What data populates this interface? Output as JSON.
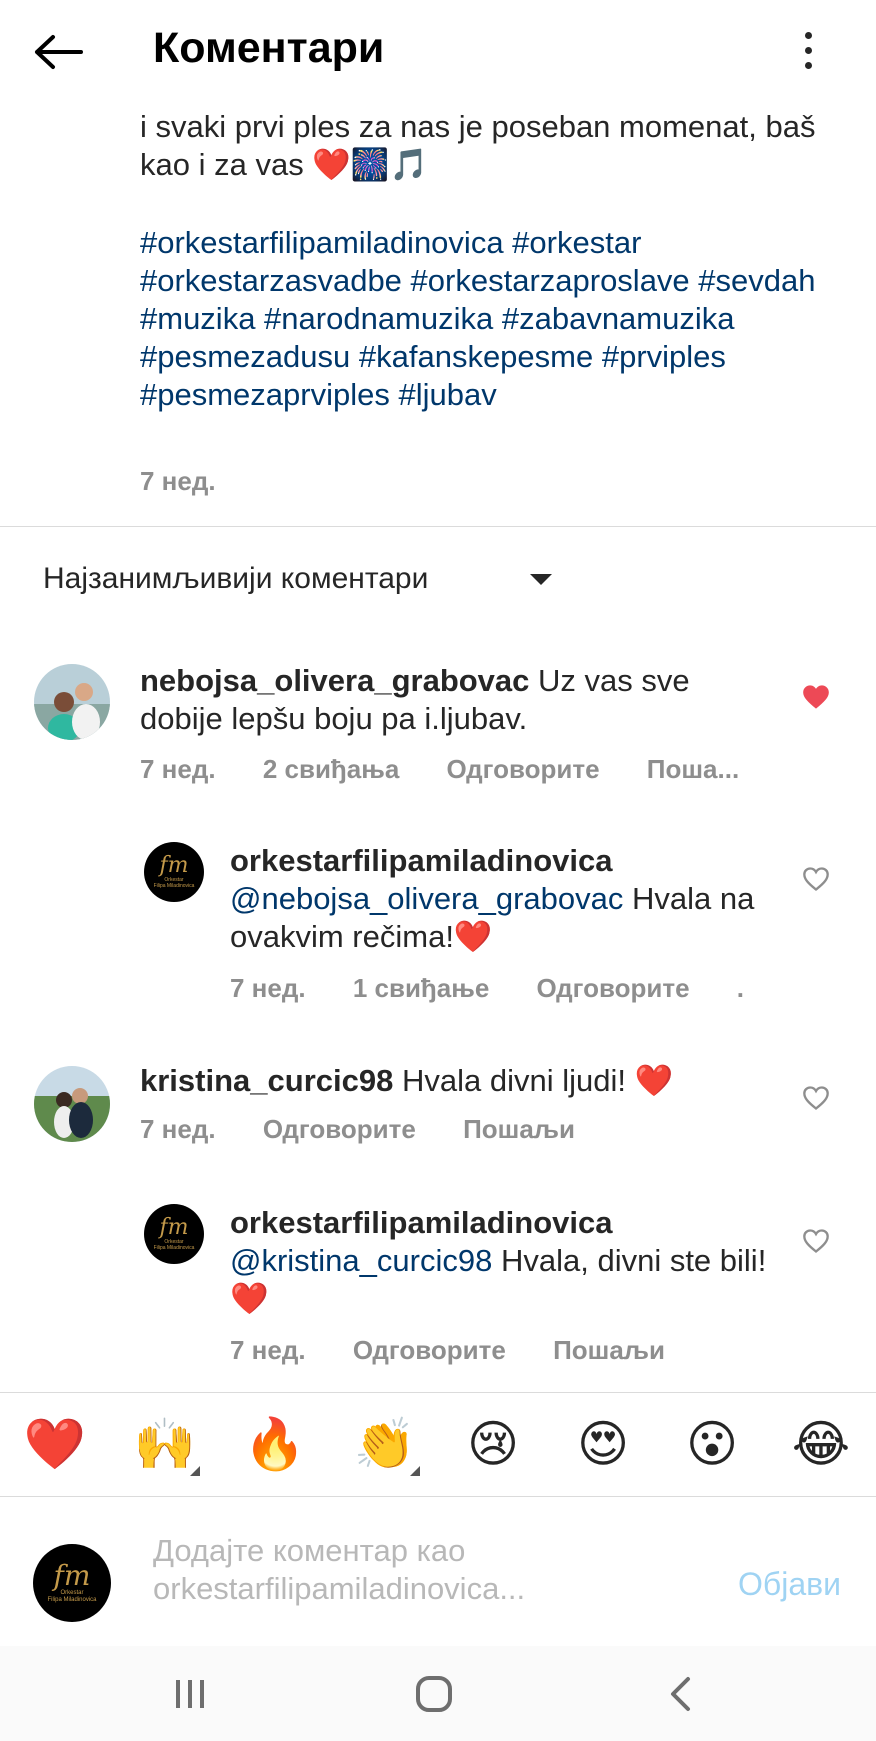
{
  "header": {
    "back_icon": "arrow-left-icon",
    "title": "Коментари",
    "menu_icon": "more-vertical-icon"
  },
  "caption": {
    "text": "i svaki prvi ples za nas je poseban momenat, baš kao i za vas",
    "emojis": "❤️🎆🎵",
    "hashtags": "#orkestarfilipamiladinovica #orkestar #orkestarzasvadbe #orkestarzaproslave #sevdah #muzika #narodnamuzika #zabavnamuzika #pesmezadusu #kafanskepesme #prviples #pesmezaprviples #ljubav",
    "time": "7 нед."
  },
  "sort": {
    "label": "Најзанимљивији коментари",
    "icon": "caret-down-icon"
  },
  "comments": [
    {
      "username": "nebojsa_olivera_grabovac",
      "text": "Uz vas sve dobije lepšu boju pa i.ljubav.",
      "time": "7 нед.",
      "likes": "2 свиђања",
      "reply": "Одговорите",
      "send": "Поша...",
      "liked": true
    },
    {
      "username": "orkestarfilipamiladinovica",
      "mention": "@nebojsa_olivera_grabovac",
      "text": "Hvala na ovakvim rečima!❤️",
      "time": "7 нед.",
      "likes": "1 свиђање",
      "reply": "Одговорите",
      "send": ".",
      "liked": false
    },
    {
      "username": "kristina_curcic98",
      "text": "Hvala divni ljudi! ❤️",
      "time": "7 нед.",
      "reply": "Одговорите",
      "send": "Пошаљи",
      "liked": false
    },
    {
      "username": "orkestarfilipamiladinovica",
      "mention": "@kristina_curcic98",
      "text": "Hvala, divni ste bili!❤️",
      "time": "7 нед.",
      "reply": "Одговорите",
      "send": "Пошаљи",
      "liked": false
    }
  ],
  "logo_text": {
    "mark": "fm",
    "sub1": "Orkestar",
    "sub2": "Filipa Miladinovica"
  },
  "emoji_bar": [
    "❤️",
    "🙌",
    "🔥",
    "👏",
    "😢",
    "😍",
    "😮",
    "😂"
  ],
  "composer": {
    "placeholder_line1": "Додајте коментар као",
    "placeholder_line2": "orkestarfilipamiladinovica...",
    "post_label": "Објави"
  },
  "navbar": {
    "recent_icon": "recent-apps-icon",
    "home_icon": "home-icon",
    "back_icon": "nav-back-icon"
  },
  "colors": {
    "hashtag": "#00376b",
    "liked_heart": "#ed4956",
    "muted_text": "#8e8e8e",
    "post_button": "#9fd3f3"
  }
}
